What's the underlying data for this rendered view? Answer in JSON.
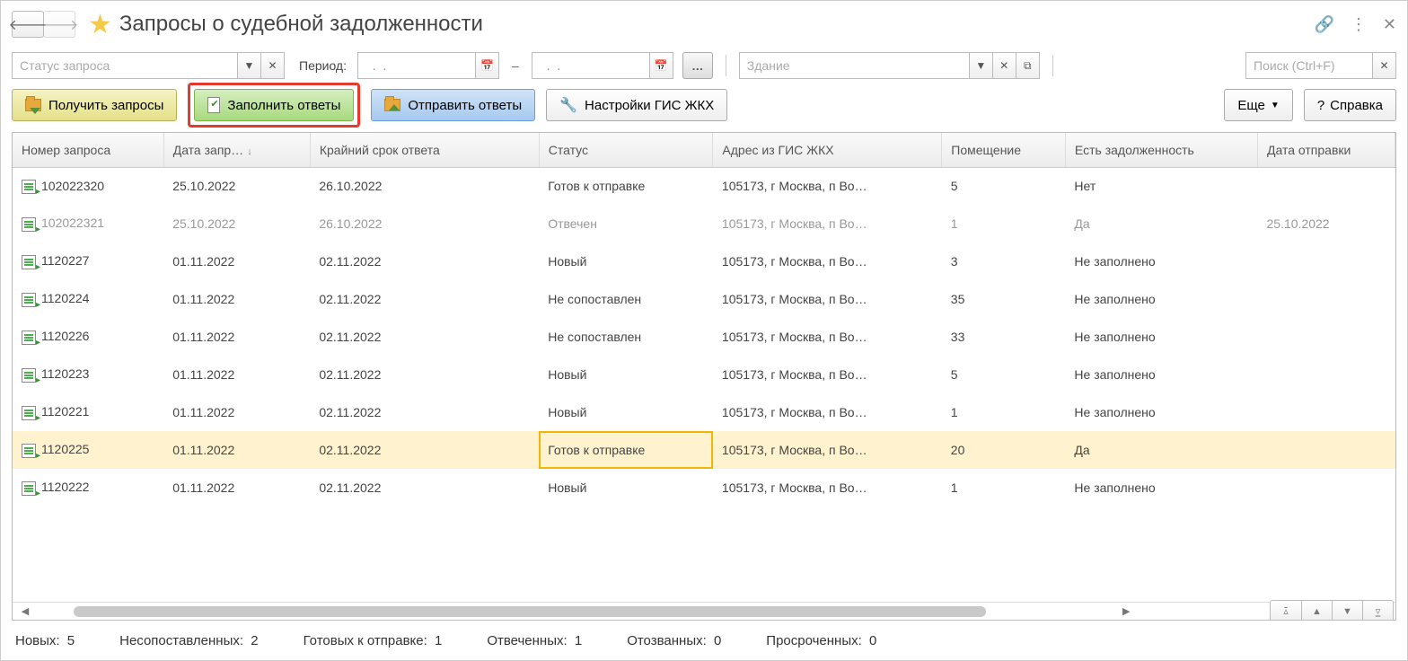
{
  "header": {
    "title": "Запросы о судебной задолженности"
  },
  "filter": {
    "status_placeholder": "Статус запроса",
    "period_label": "Период:",
    "date_from_value": "  .  .",
    "date_to_value": "  .  .",
    "building_placeholder": "Здание",
    "search_placeholder": "Поиск (Ctrl+F)"
  },
  "toolbar": {
    "get_requests": "Получить запросы",
    "fill_answers": "Заполнить ответы",
    "send_answers": "Отправить ответы",
    "settings": "Настройки ГИС ЖКХ",
    "more": "Еще",
    "help": "Справка"
  },
  "columns": {
    "c0": "Номер запроса",
    "c1": "Дата запр…",
    "c2": "Крайний срок ответа",
    "c3": "Статус",
    "c4": "Адрес из ГИС ЖКХ",
    "c5": "Помещение",
    "c6": "Есть задолженность",
    "c7": "Дата отправки"
  },
  "rows": [
    {
      "num": "102022320",
      "date": "25.10.2022",
      "dead": "26.10.2022",
      "stat": "Готов к отправке",
      "addr": "105173, г Москва, п Во…",
      "room": "5",
      "debt": "Нет",
      "send": "",
      "dim": false,
      "sel": false
    },
    {
      "num": "102022321",
      "date": "25.10.2022",
      "dead": "26.10.2022",
      "stat": "Отвечен",
      "addr": "105173, г Москва, п Во…",
      "room": "1",
      "debt": "Да",
      "send": "25.10.2022",
      "dim": true,
      "sel": false
    },
    {
      "num": "1120227",
      "date": "01.11.2022",
      "dead": "02.11.2022",
      "stat": "Новый",
      "addr": "105173, г Москва, п Во…",
      "room": "3",
      "debt": "Не заполнено",
      "send": "",
      "dim": false,
      "sel": false
    },
    {
      "num": "1120224",
      "date": "01.11.2022",
      "dead": "02.11.2022",
      "stat": "Не сопоставлен",
      "addr": "105173, г Москва, п Во…",
      "room": "35",
      "debt": "Не заполнено",
      "send": "",
      "dim": false,
      "sel": false
    },
    {
      "num": "1120226",
      "date": "01.11.2022",
      "dead": "02.11.2022",
      "stat": "Не сопоставлен",
      "addr": "105173, г Москва, п Во…",
      "room": "33",
      "debt": "Не заполнено",
      "send": "",
      "dim": false,
      "sel": false
    },
    {
      "num": "1120223",
      "date": "01.11.2022",
      "dead": "02.11.2022",
      "stat": "Новый",
      "addr": "105173, г Москва, п Во…",
      "room": "5",
      "debt": "Не заполнено",
      "send": "",
      "dim": false,
      "sel": false
    },
    {
      "num": "1120221",
      "date": "01.11.2022",
      "dead": "02.11.2022",
      "stat": "Новый",
      "addr": "105173, г Москва, п Во…",
      "room": "1",
      "debt": "Не заполнено",
      "send": "",
      "dim": false,
      "sel": false
    },
    {
      "num": "1120225",
      "date": "01.11.2022",
      "dead": "02.11.2022",
      "stat": "Готов к отправке",
      "addr": "105173, г Москва, п Во…",
      "room": "20",
      "debt": "Да",
      "send": "",
      "dim": false,
      "sel": true
    },
    {
      "num": "1120222",
      "date": "01.11.2022",
      "dead": "02.11.2022",
      "stat": "Новый",
      "addr": "105173, г Москва, п Во…",
      "room": "1",
      "debt": "Не заполнено",
      "send": "",
      "dim": false,
      "sel": false
    }
  ],
  "footer": {
    "new_lbl": "Новых:",
    "new_val": "5",
    "unmatched_lbl": "Несопоставленных:",
    "unmatched_val": "2",
    "ready_lbl": "Готовых к отправке:",
    "ready_val": "1",
    "answered_lbl": "Отвеченных:",
    "answered_val": "1",
    "revoked_lbl": "Отозванных:",
    "revoked_val": "0",
    "overdue_lbl": "Просроченных:",
    "overdue_val": "0"
  }
}
